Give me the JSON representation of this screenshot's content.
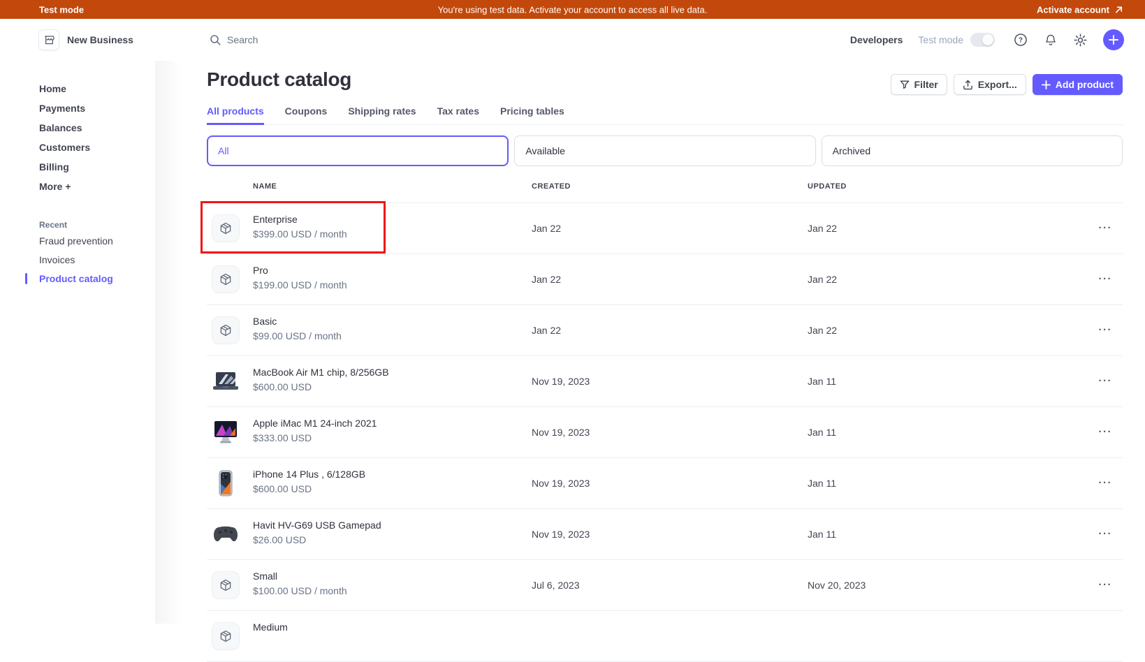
{
  "banner": {
    "mode_label": "Test mode",
    "message": "You're using test data. Activate your account to access all live data.",
    "action_label": "Activate account",
    "bg_color": "#C2490B"
  },
  "header": {
    "business_name": "New Business",
    "search_placeholder": "Search",
    "developers_label": "Developers",
    "test_mode_label": "Test mode",
    "icons": [
      "help-icon",
      "notifications-icon",
      "settings-icon",
      "add-icon"
    ]
  },
  "sidebar": {
    "items": [
      "Home",
      "Payments",
      "Balances",
      "Customers",
      "Billing",
      "More +"
    ],
    "recent_label": "Recent",
    "recent_items": [
      "Fraud prevention",
      "Invoices",
      "Product catalog"
    ],
    "active_item": "Product catalog"
  },
  "page": {
    "title": "Product catalog",
    "tabs": [
      "All products",
      "Coupons",
      "Shipping rates",
      "Tax rates",
      "Pricing tables"
    ],
    "active_tab": "All products",
    "filter_button": "Filter",
    "export_button": "Export...",
    "add_product_button": "Add product",
    "segments": [
      "All",
      "Available",
      "Archived"
    ],
    "active_segment": "All"
  },
  "table": {
    "columns": [
      "NAME",
      "CREATED",
      "UPDATED"
    ],
    "overflow_menu_glyph": "···",
    "rows": [
      {
        "name": "Enterprise",
        "price": "$399.00 USD / month",
        "created": "Jan 22",
        "updated": "Jan 22",
        "thumb": "package-icon",
        "annotated": true
      },
      {
        "name": "Pro",
        "price": "$199.00 USD / month",
        "created": "Jan 22",
        "updated": "Jan 22",
        "thumb": "package-icon"
      },
      {
        "name": "Basic",
        "price": "$99.00 USD / month",
        "created": "Jan 22",
        "updated": "Jan 22",
        "thumb": "package-icon"
      },
      {
        "name": "MacBook Air M1 chip, 8/256GB",
        "price": "$600.00 USD",
        "created": "Nov 19, 2023",
        "updated": "Jan 11",
        "thumb": "macbook-photo"
      },
      {
        "name": "Apple iMac M1 24-inch 2021",
        "price": "$333.00 USD",
        "created": "Nov 19, 2023",
        "updated": "Jan 11",
        "thumb": "imac-photo"
      },
      {
        "name": "iPhone 14 Plus , 6/128GB",
        "price": "$600.00 USD",
        "created": "Nov 19, 2023",
        "updated": "Jan 11",
        "thumb": "iphone-photo"
      },
      {
        "name": "Havit HV-G69 USB Gamepad",
        "price": "$26.00 USD",
        "created": "Nov 19, 2023",
        "updated": "Jan 11",
        "thumb": "gamepad-photo"
      },
      {
        "name": "Small",
        "price": "$100.00 USD / month",
        "created": "Jul 6, 2023",
        "updated": "Nov 20, 2023",
        "thumb": "package-icon"
      },
      {
        "name": "Medium",
        "price": "",
        "created": "",
        "updated": "",
        "thumb": "package-icon"
      }
    ]
  },
  "annotation": {
    "target_row": "Enterprise",
    "color": "#F21414"
  },
  "colors": {
    "accent": "#635BFF",
    "banner": "#C2490B",
    "text_dark": "#30313D",
    "text_medium": "#414552",
    "text_gray": "#687385",
    "border": "#D8DEE4",
    "row_divider": "#EBEEF1",
    "annotation_red": "#F21414"
  }
}
